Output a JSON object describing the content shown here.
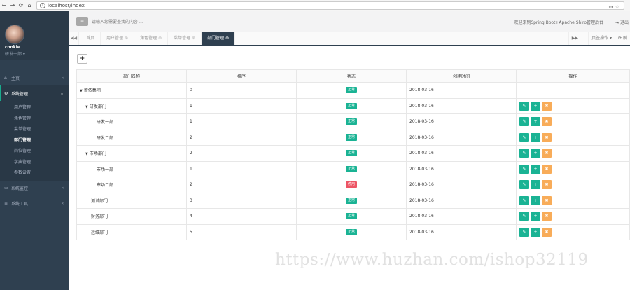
{
  "browser": {
    "url": "localhost/index",
    "nav": [
      "←",
      "→",
      "⟳",
      "⌂"
    ],
    "right": "⊶ ☆"
  },
  "sidebar": {
    "user_name": "cookie",
    "user_dept": "研发一部 ▾",
    "menu": [
      {
        "icon": "⌂",
        "label": "主页",
        "arrow": "‹"
      },
      {
        "icon": "⚙",
        "label": "系统管理",
        "arrow": "⌄",
        "active": true
      },
      {
        "icon": "▭",
        "label": "系统监控",
        "arrow": "‹"
      },
      {
        "icon": "≡",
        "label": "系统工具",
        "arrow": "‹"
      }
    ],
    "submenu": [
      "用户管理",
      "角色管理",
      "菜单管理",
      "部门管理",
      "岗位管理",
      "字典管理",
      "参数设置"
    ]
  },
  "topbar": {
    "toggle": "≡",
    "search_placeholder": "请输入您需要查找的内容 …",
    "welcome": "欢迎来到Spring Boot+Apache Shiro管理后台",
    "logout": "⇥ 退出"
  },
  "tabs": {
    "left_nav": "◀◀",
    "items": [
      "首页",
      "用户管理",
      "角色管理",
      "菜单管理",
      "部门管理"
    ],
    "right_nav": "▶▶",
    "page_ops": "页签操作 ▾",
    "refresh": "⟳ 刷"
  },
  "content": {
    "add_label": "+",
    "headers": [
      "部门名称",
      "排序",
      "状态",
      "创建时间",
      "操作"
    ],
    "rows": [
      {
        "name": "若依集团",
        "sort": "0",
        "status": "正常",
        "time": "2018-03-16"
      },
      {
        "name": "研发部门",
        "sort": "1",
        "status": "正常",
        "time": "2018-03-16"
      },
      {
        "name": "研发一部",
        "sort": "1",
        "status": "正常",
        "time": "2018-03-16"
      },
      {
        "name": "研发二部",
        "sort": "2",
        "status": "正常",
        "time": "2018-03-16"
      },
      {
        "name": "市场部门",
        "sort": "2",
        "status": "正常",
        "time": "2018-03-16"
      },
      {
        "name": "市场一部",
        "sort": "1",
        "status": "正常",
        "time": "2018-03-16"
      },
      {
        "name": "市场二部",
        "sort": "2",
        "status": "停用",
        "time": "2018-03-16"
      },
      {
        "name": "测试部门",
        "sort": "3",
        "status": "正常",
        "time": "2018-03-16"
      },
      {
        "name": "财务部门",
        "sort": "4",
        "status": "正常",
        "time": "2018-03-16"
      },
      {
        "name": "运维部门",
        "sort": "5",
        "status": "正常",
        "time": "2018-03-16"
      }
    ],
    "op_icons": {
      "edit": "✎",
      "add": "+",
      "delete": "✖"
    }
  },
  "watermark": "https://www.huzhan.com/ishop32119"
}
